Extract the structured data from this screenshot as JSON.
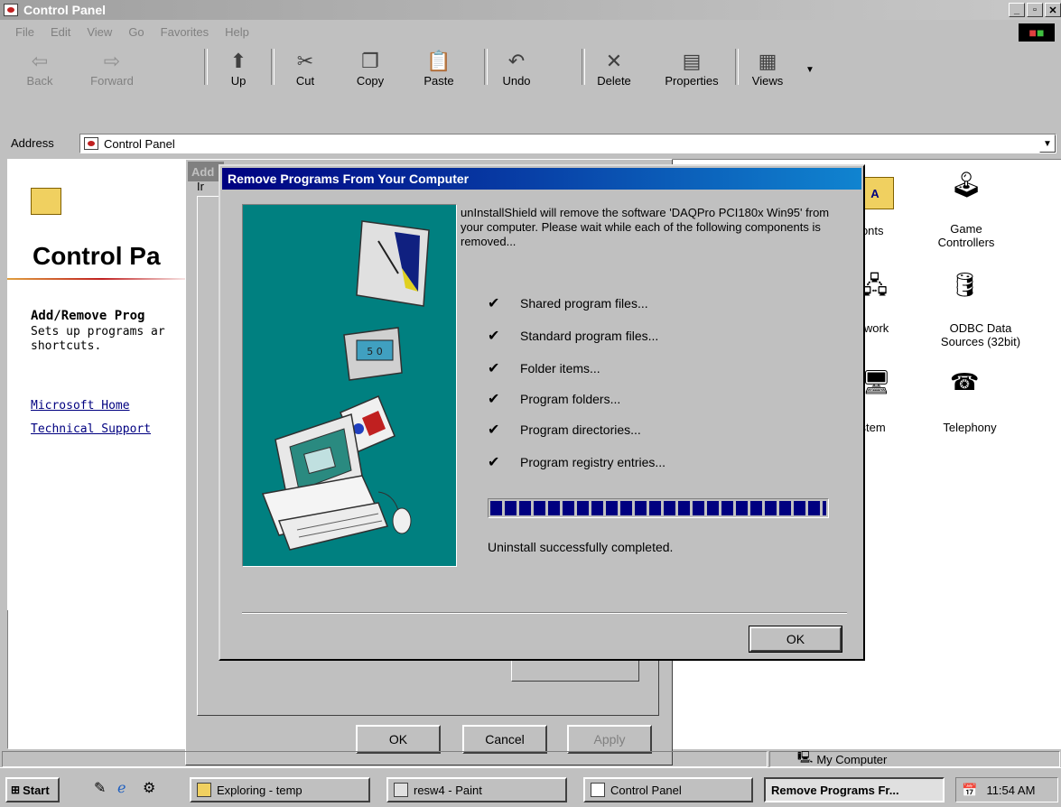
{
  "window": {
    "title": "Control Panel"
  },
  "menu": [
    "File",
    "Edit",
    "View",
    "Go",
    "Favorites",
    "Help"
  ],
  "toolbar": [
    {
      "label": "Back",
      "icon": "back-arrow-icon",
      "glyph": "⇦",
      "disabled": true
    },
    {
      "label": "Forward",
      "icon": "forward-arrow-icon",
      "glyph": "⇨",
      "disabled": true
    },
    {
      "label": "Up",
      "icon": "up-folder-icon",
      "glyph": "⬆",
      "disabled": false
    },
    {
      "label": "Cut",
      "icon": "scissors-icon",
      "glyph": "✂",
      "disabled": false
    },
    {
      "label": "Copy",
      "icon": "copy-icon",
      "glyph": "❐",
      "disabled": false
    },
    {
      "label": "Paste",
      "icon": "paste-icon",
      "glyph": "📋",
      "disabled": false
    },
    {
      "label": "Undo",
      "icon": "undo-icon",
      "glyph": "↶",
      "disabled": false
    },
    {
      "label": "Delete",
      "icon": "delete-x-icon",
      "glyph": "✕",
      "disabled": false
    },
    {
      "label": "Properties",
      "icon": "properties-icon",
      "glyph": "▤",
      "disabled": false
    },
    {
      "label": "Views",
      "icon": "views-grid-icon",
      "glyph": "▦",
      "disabled": false
    }
  ],
  "address": {
    "label": "Address",
    "value": "Control Panel"
  },
  "left_panel": {
    "title": "Control Pa",
    "item_title": "Add/Remove Prog",
    "desc_line1": "Sets up programs ar",
    "desc_line2": "shortcuts.",
    "link1": "Microsoft Home",
    "link2": "Technical Support"
  },
  "bg_dialog": {
    "title_fragment": "Add",
    "tab_fragment": "Ir",
    "ok": "OK",
    "cancel": "Cancel",
    "apply": "Apply"
  },
  "right_icons": [
    {
      "label": "Fonts",
      "icon": "fonts-folder-icon"
    },
    {
      "label": "Game\nControllers",
      "icon": "joystick-icon"
    },
    {
      "label": "etwork",
      "icon": "network-icon"
    },
    {
      "label": "ODBC Data\nSources (32bit)",
      "icon": "odbc-icon"
    },
    {
      "label": "ystem",
      "icon": "system-computer-icon"
    },
    {
      "label": "Telephony",
      "icon": "telephony-icon"
    }
  ],
  "dialog": {
    "title": "Remove Programs From Your Computer",
    "message": "unInstallShield will remove the software 'DAQPro PCI180x Win95' from your computer.  Please wait while each of the following components is removed...",
    "steps": [
      "Shared program files...",
      "Standard program files...",
      "Folder items...",
      "Program folders...",
      "Program directories...",
      "Program registry entries..."
    ],
    "check_glyph": "✔",
    "progress_percent": 100,
    "status": "Uninstall successfully completed.",
    "ok": "OK"
  },
  "statusbar": {
    "location": "My Computer"
  },
  "taskbar": {
    "start": "Start",
    "tasks": [
      "Exploring - temp",
      "resw4 - Paint",
      "Control Panel",
      "Remove Programs Fr..."
    ],
    "clock": "11:54 AM"
  }
}
